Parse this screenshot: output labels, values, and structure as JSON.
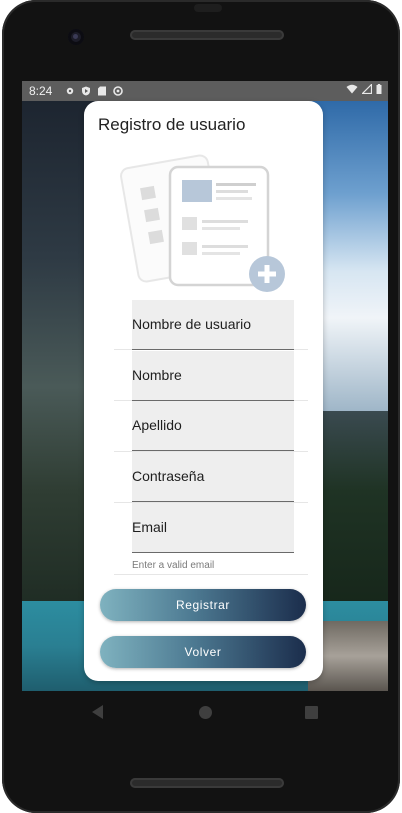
{
  "status_bar": {
    "time": "8:24",
    "left_icons": [
      "settings-icon",
      "shield-icon",
      "sd-card-icon",
      "sync-icon"
    ],
    "right_icons": [
      "wifi-icon",
      "signal-icon",
      "battery-icon"
    ]
  },
  "form": {
    "title": "Registro de usuario",
    "fields": [
      {
        "label": "Nombre de usuario"
      },
      {
        "label": "Nombre"
      },
      {
        "label": "Apellido"
      },
      {
        "label": "Contraseña"
      },
      {
        "label": "Email"
      }
    ],
    "email_helper": "Enter a valid email",
    "register_button": "Registrar",
    "back_button": "Volver"
  },
  "colors": {
    "button_gradient_start": "#7fb2bf",
    "button_gradient_end": "#1b2d4c",
    "illustration_blue": "#b7c7d9"
  }
}
